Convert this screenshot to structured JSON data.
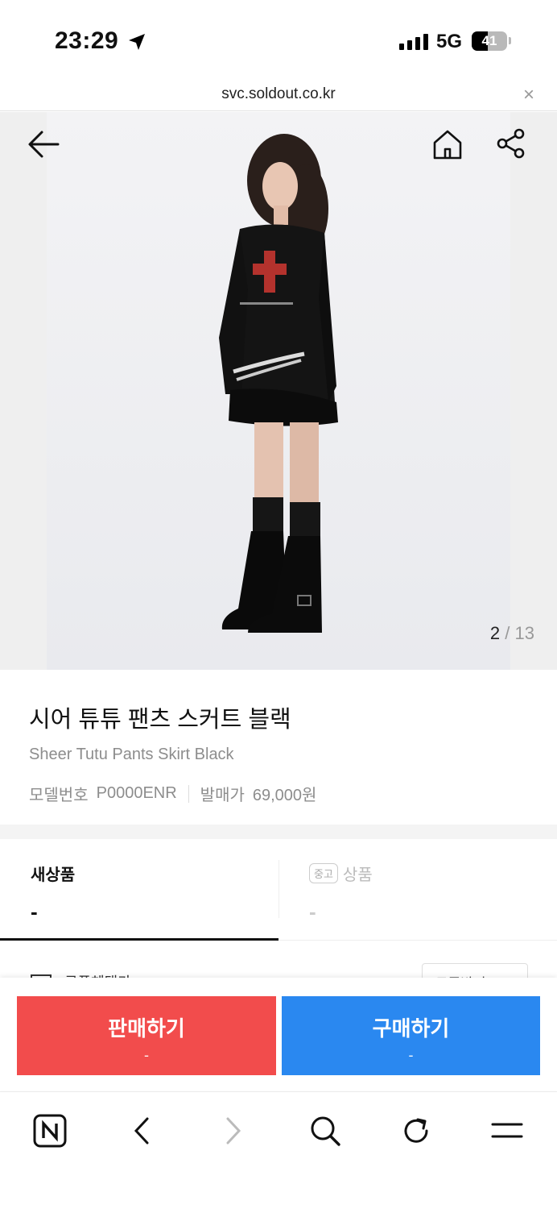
{
  "status_bar": {
    "time": "23:29",
    "network": "5G",
    "battery": "41",
    "signal_bars": 4
  },
  "browser": {
    "url": "svc.soldout.co.kr",
    "close_icon": "close-icon"
  },
  "gallery": {
    "current": "2",
    "separator": "/",
    "total": "13"
  },
  "product": {
    "title_ko": "시어 튜튜 팬츠 스커트 블랙",
    "title_en": "Sheer Tutu Pants Skirt Black",
    "model_label": "모델번호",
    "model_number": "P0000ENR",
    "release_label": "발매가",
    "release_price": "69,000원"
  },
  "tabs": [
    {
      "label": "새상품",
      "price": "-",
      "active": true
    },
    {
      "chip": "중고",
      "label": "상품",
      "price": "-",
      "active": false
    }
  ],
  "peek_row": {
    "text": "쿠폰혜택가",
    "button": "쿠폰받기 ↓"
  },
  "actions": {
    "sell": {
      "label": "판매하기",
      "price": "-"
    },
    "buy": {
      "label": "구매하기",
      "price": "-"
    }
  },
  "colors": {
    "sell": "#f24c4c",
    "buy": "#2a88f0",
    "active_tab": "#111111"
  },
  "toolbar_icons": [
    "naver-icon",
    "back-icon",
    "forward-icon",
    "search-icon",
    "reload-icon",
    "menu-icon"
  ]
}
